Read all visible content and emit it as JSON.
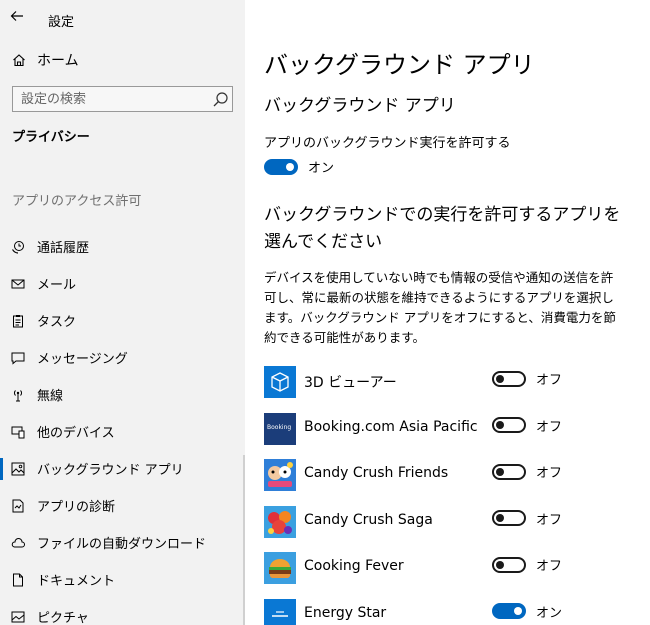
{
  "window": {
    "title": "設定"
  },
  "sidebar": {
    "home_label": "ホーム",
    "search_placeholder": "設定の検索",
    "group_title": "プライバシー",
    "section_title": "アプリのアクセス許可",
    "items": [
      {
        "label": "通話履歴",
        "icon": "call-history-icon",
        "selected": false
      },
      {
        "label": "メール",
        "icon": "mail-icon",
        "selected": false
      },
      {
        "label": "タスク",
        "icon": "tasks-icon",
        "selected": false
      },
      {
        "label": "メッセージング",
        "icon": "message-icon",
        "selected": false
      },
      {
        "label": "無線",
        "icon": "radio-icon",
        "selected": false
      },
      {
        "label": "他のデバイス",
        "icon": "devices-icon",
        "selected": false
      },
      {
        "label": "バックグラウンド アプリ",
        "icon": "background-apps-icon",
        "selected": true
      },
      {
        "label": "アプリの診断",
        "icon": "diagnostics-icon",
        "selected": false
      },
      {
        "label": "ファイルの自動ダウンロード",
        "icon": "cloud-icon",
        "selected": false
      },
      {
        "label": "ドキュメント",
        "icon": "document-icon",
        "selected": false
      },
      {
        "label": "ピクチャ",
        "icon": "picture-icon",
        "selected": false
      }
    ]
  },
  "main": {
    "page_title": "バックグラウンド アプリ",
    "sub_title": "バックグラウンド アプリ",
    "allow_label": "アプリのバックグラウンド実行を許可する",
    "allow_state": "オン",
    "choose_heading": "バックグラウンドでの実行を許可するアプリを選んでください",
    "description": "デバイスを使用していない時でも情報の受信や通知の送信を許可し、常に最新の状態を維持できるようにするアプリを選択します。バックグラウンド アプリをオフにすると、消費電力を節約できる可能性があります。",
    "apps": [
      {
        "name": "3D ビューアー",
        "state": "オフ",
        "on": false,
        "icon": "cube-icon",
        "icon_text": ""
      },
      {
        "name": "Booking.com Asia Pacific",
        "state": "オフ",
        "on": false,
        "icon": "booking-icon",
        "icon_text": "Booking"
      },
      {
        "name": "Candy Crush Friends",
        "state": "オフ",
        "on": false,
        "icon": "candy-crush-friends-icon",
        "icon_text": ""
      },
      {
        "name": "Candy Crush Saga",
        "state": "オフ",
        "on": false,
        "icon": "candy-crush-saga-icon",
        "icon_text": ""
      },
      {
        "name": "Cooking Fever",
        "state": "オフ",
        "on": false,
        "icon": "cooking-fever-icon",
        "icon_text": ""
      },
      {
        "name": "Energy Star",
        "state": "オン",
        "on": true,
        "icon": "energy-star-icon",
        "icon_text": ""
      }
    ]
  },
  "colors": {
    "accent": "#0067c0",
    "sidebar_bg": "#f2f2f2",
    "booking_blue": "#1b3d7a"
  }
}
